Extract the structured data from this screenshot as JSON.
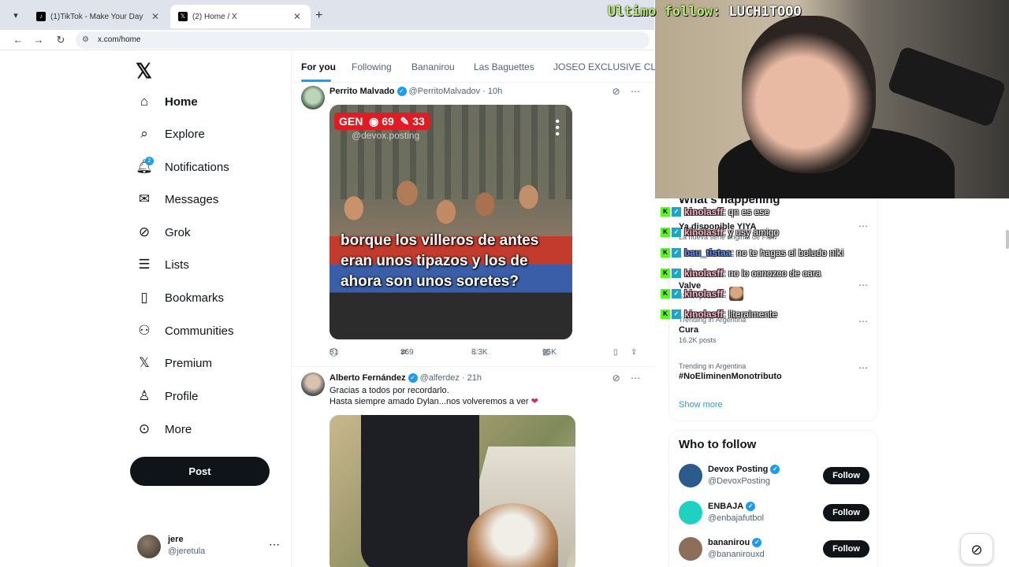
{
  "browser": {
    "tabs": [
      {
        "title": "(1)TikTok - Make Your Day",
        "favicon": "tiktok-icon"
      },
      {
        "title": "(2) Home / X",
        "favicon": "x-icon"
      }
    ],
    "url": "x.com/home"
  },
  "stream_overlay": {
    "follow_label": "Ultimo follow:",
    "follow_name": "LUCH1TOOO"
  },
  "nav": {
    "items": [
      {
        "label": "Home",
        "icon": "home-icon",
        "active": true
      },
      {
        "label": "Explore",
        "icon": "search-icon"
      },
      {
        "label": "Notifications",
        "icon": "bell-icon",
        "badge": "2"
      },
      {
        "label": "Messages",
        "icon": "mail-icon"
      },
      {
        "label": "Grok",
        "icon": "grok-icon"
      },
      {
        "label": "Lists",
        "icon": "list-icon"
      },
      {
        "label": "Bookmarks",
        "icon": "bookmark-icon"
      },
      {
        "label": "Communities",
        "icon": "people-icon"
      },
      {
        "label": "Premium",
        "icon": "x-icon"
      },
      {
        "label": "Profile",
        "icon": "person-icon"
      },
      {
        "label": "More",
        "icon": "more-circle-icon"
      }
    ],
    "post_label": "Post",
    "account": {
      "name": "jere",
      "handle": "@jeretula"
    }
  },
  "feed": {
    "tabs": [
      "For you",
      "Following",
      "Bananirou",
      "Las Baguettes",
      "JOSEO EXCLUSIVE CLU"
    ],
    "tweets": [
      {
        "name": "Perrito Malvado",
        "handle": "@PerritoMalvadov",
        "time": "· 10h",
        "media": {
          "gen_label": "GEN",
          "views": "69",
          "edits": "33",
          "watermark": "@devox.posting",
          "caption": "borque los villeros de antes eran unos tipazos y los de ahora son unos soretes?"
        },
        "stats": {
          "replies": "81",
          "reposts": "369",
          "likes": "8.3K",
          "views": "95K"
        }
      },
      {
        "name": "Alberto Fernández",
        "handle": "@alferdez",
        "time": "· 21h",
        "text_line1": "Gracias a todos por recordarlo.",
        "text_line2": "Hasta siempre amado Dylan...nos volveremos a ver"
      }
    ]
  },
  "right": {
    "whats_happening": "What's happening",
    "trends": [
      {
        "context": "",
        "title": "Ya disponible YIYA",
        "count": "La nueva serie original de Flow"
      },
      {
        "context": "",
        "title": "Valve",
        "count": "62.4K posts"
      },
      {
        "context": "Trending in Argentina",
        "title": "Cura",
        "count": "16.2K posts"
      },
      {
        "context": "Trending in Argentina",
        "title": "#NoEliminenMonotributo",
        "count": ""
      }
    ],
    "show_more": "Show more",
    "who_to_follow": "Who to follow",
    "suggestions": [
      {
        "name": "Devox Posting",
        "handle": "@DevoxPosting",
        "avatar_color": "#2a5b8c"
      },
      {
        "name": "ENBAJA",
        "handle": "@enbajafutbol",
        "avatar_color": "#1fd1c1"
      },
      {
        "name": "bananirou",
        "handle": "@bananirouxd",
        "avatar_color": "#8d6e5a"
      }
    ],
    "follow_label": "Follow"
  },
  "chat": [
    {
      "user": "kinolasff",
      "message": ": qn es ese"
    },
    {
      "user": "kinolasff",
      "message": ": y usy amigo"
    },
    {
      "user": "bau_tistaa",
      "message": ": no te hagas el boludo niki",
      "blue": true
    },
    {
      "user": "kinolasff",
      "message": ": no lo conozco de cara"
    },
    {
      "user": "kinolasff",
      "message": ":",
      "emote": true
    },
    {
      "user": "kinolasff",
      "message": ": literalmente"
    }
  ]
}
